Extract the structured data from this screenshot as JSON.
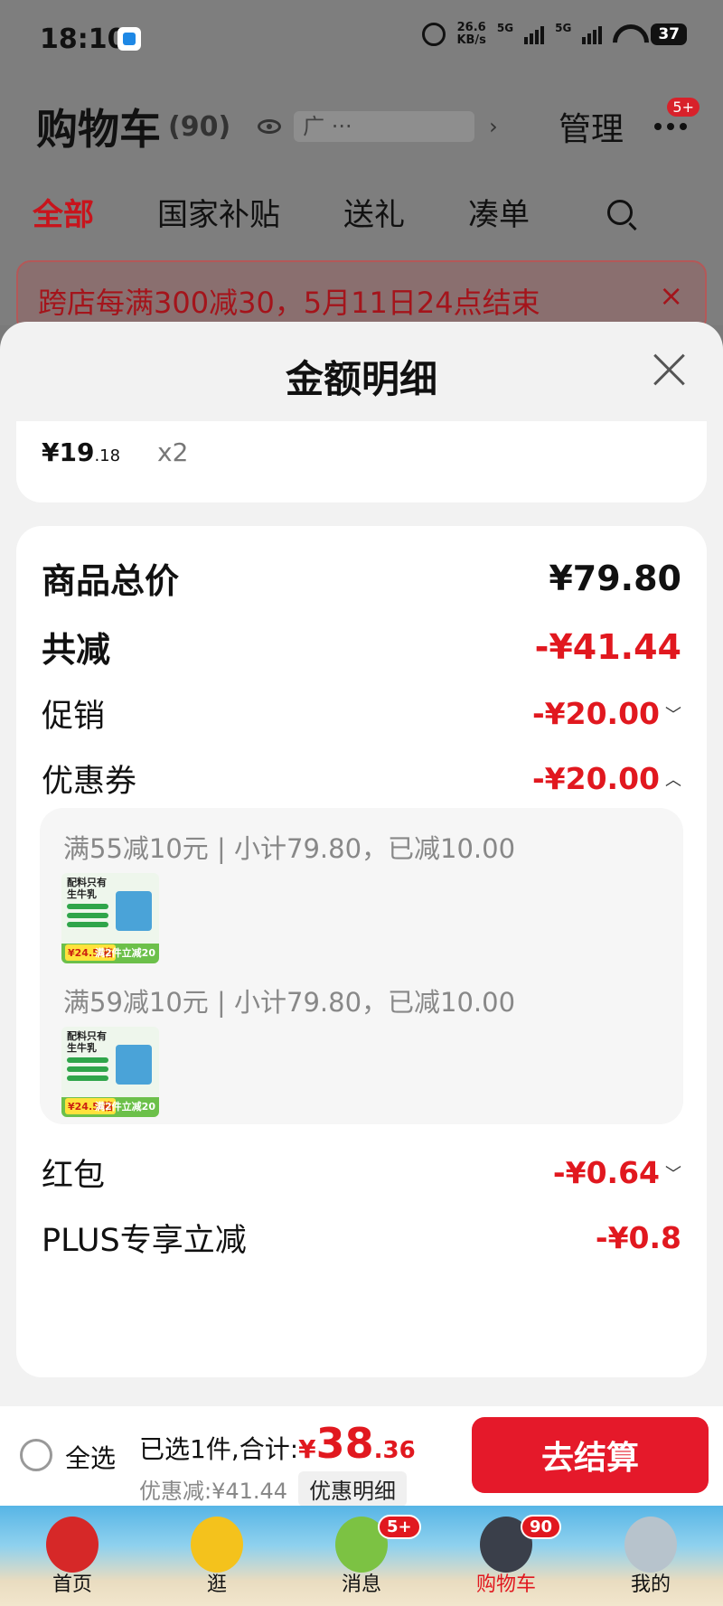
{
  "status_bar": {
    "time": "18:10",
    "net_speed": "26.6",
    "net_unit": "KB/s",
    "signal1": "5G",
    "signal2": "5G",
    "battery": "37"
  },
  "header": {
    "title": "购物车",
    "count": "(90)",
    "address_hint": "广 ···",
    "manage_label": "管理",
    "more_badge": "5+"
  },
  "tabs": [
    {
      "label": "全部",
      "active": true
    },
    {
      "label": "国家补贴"
    },
    {
      "label": "送礼"
    },
    {
      "label": "凑单"
    }
  ],
  "promo_bar": {
    "text": "跨店每满300减30，5月11日24点结束",
    "close": "×"
  },
  "sheet": {
    "title": "金额明细",
    "item": {
      "price_int": "¥19",
      "price_dec": ".18",
      "qty": "x2"
    },
    "rows": {
      "total_label": "商品总价",
      "total_value": "¥79.80",
      "reduce_label": "共减",
      "reduce_value": "-¥41.44",
      "promo_label": "促销",
      "promo_value": "-¥20.00",
      "coupon_label": "优惠券",
      "coupon_value": "-¥20.00",
      "redpack_label": "红包",
      "redpack_value": "-¥0.64",
      "plus_label": "PLUS专享立减",
      "plus_value": "-¥0.8"
    },
    "coupons": [
      {
        "text": "满55减10元 | 小计79.80，已减10.00",
        "thumb_title": "配料只有\n生牛乳",
        "thumb_price": "¥24.5/箱",
        "thumb_promo": "满2件立减20"
      },
      {
        "text": "满59减10元 | 小计79.80，已减10.00",
        "thumb_title": "配料只有\n生牛乳",
        "thumb_price": "¥24.5/箱",
        "thumb_promo": "满2件立减20"
      }
    ]
  },
  "action_bar": {
    "select_all": "全选",
    "selected_prefix": "已选1件,合计:",
    "currency": "¥",
    "total_int": "38",
    "total_dec": ".36",
    "discount_text": "优惠减:¥41.44",
    "detail_label": "优惠明细",
    "checkout_label": "去结算"
  },
  "tabbar": {
    "items": [
      {
        "label": "首页",
        "icon": "red-bird-icon",
        "color": "#d62828"
      },
      {
        "label": "逛",
        "icon": "yellow-bird-icon",
        "color": "#f4c21c"
      },
      {
        "label": "消息",
        "icon": "green-pig-icon",
        "color": "#7cc243",
        "badge": "5+"
      },
      {
        "label": "购物车",
        "icon": "black-bird-icon",
        "color": "#3a3f4a",
        "badge": "90",
        "active": true
      },
      {
        "label": "我的",
        "icon": "grey-bird-icon",
        "color": "#b7c3cc"
      }
    ]
  },
  "colors": {
    "accent_red": "#e1181f",
    "checkout_red": "#e5192a"
  }
}
